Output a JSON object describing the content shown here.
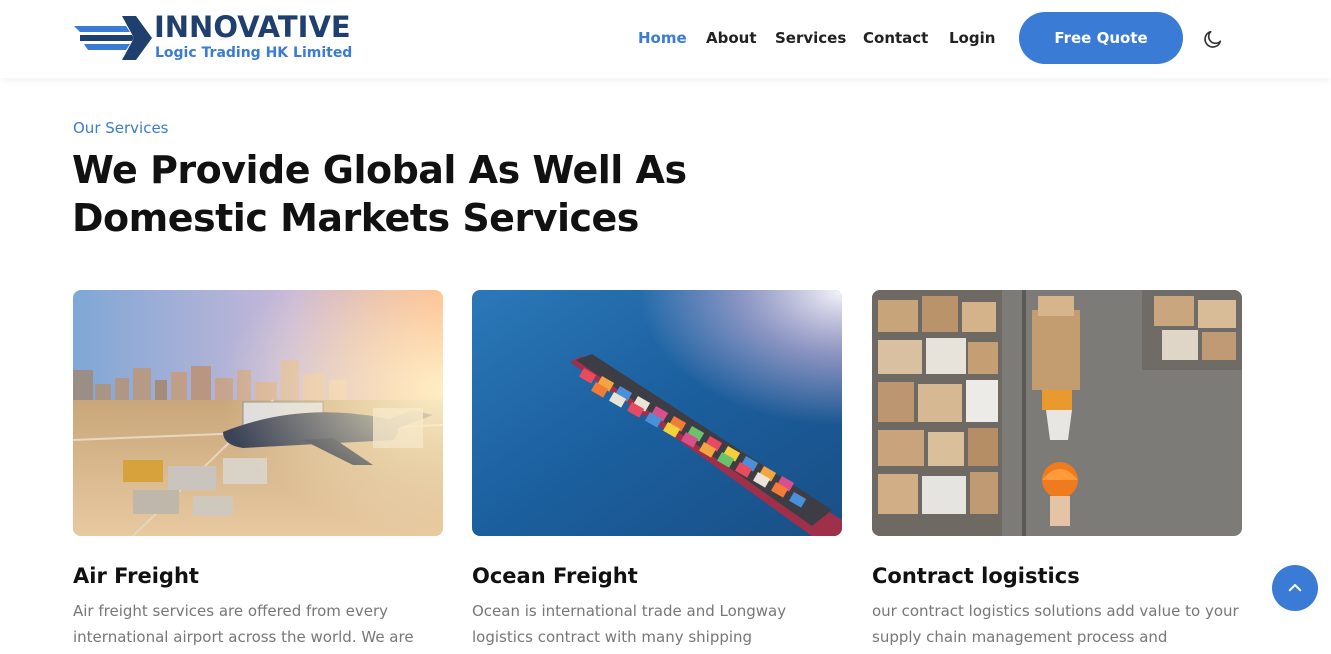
{
  "brand": {
    "title": "INNOVATIVE",
    "subtitle": "Logic Trading HK Limited",
    "primary_color": "#3a7bd5",
    "dark_color": "#1f3f6e"
  },
  "nav": {
    "items": [
      {
        "label": "Home",
        "active": true
      },
      {
        "label": "About",
        "active": false
      },
      {
        "label": "Services",
        "active": false
      },
      {
        "label": "Contact",
        "active": false
      },
      {
        "label": "Login",
        "active": false
      }
    ],
    "cta_label": "Free Quote",
    "theme_icon": "moon-icon"
  },
  "section": {
    "eyebrow": "Our Services",
    "headline_line1": "We Provide Global As Well As",
    "headline_line2": "Domestic Markets Services"
  },
  "cards": [
    {
      "title": "Air Freight",
      "text": "Air freight services are offered from every international airport across the world. We are",
      "image": "airport-cargo-image"
    },
    {
      "title": "Ocean Freight",
      "text": "Ocean is international trade and Longway logistics contract with many shipping",
      "image": "container-ship-image"
    },
    {
      "title": "Contract logistics",
      "text": "our contract logistics solutions add value to your supply chain management process and",
      "image": "warehouse-image"
    }
  ],
  "back_to_top_icon": "chevron-up-icon"
}
